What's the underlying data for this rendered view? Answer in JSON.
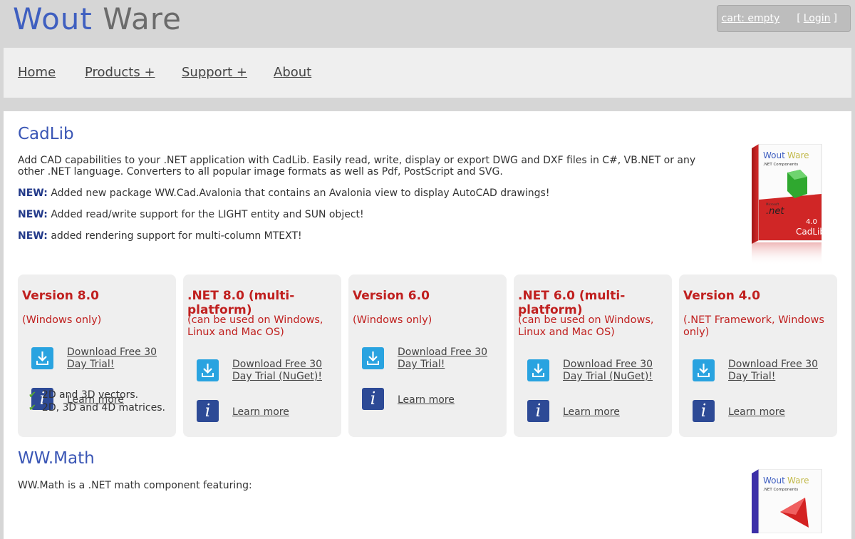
{
  "header": {
    "logo_part1": "Wout",
    "logo_part2": "Ware",
    "cart_label": "cart: empty",
    "login_open": "[",
    "login_label": "Login",
    "login_close": "]"
  },
  "nav": {
    "items": [
      {
        "label": "Home"
      },
      {
        "label": "Products +"
      },
      {
        "label": "Support +"
      },
      {
        "label": "About"
      }
    ]
  },
  "cadlib": {
    "title": "CadLib",
    "intro": "Add CAD capabilities to your .NET application with CadLib. Easily read, write, display or export DWG and DXF files in C#, VB.NET or any other .NET language. Converters to all popular image formats as well as Pdf, PostScript and SVG.",
    "news_label": "NEW:",
    "news": [
      "Added new package WW.Cad.Avalonia that contains an Avalonia view to display AutoCAD drawings!",
      "Added read/write support for the LIGHT entity and SUN object!",
      "added rendering support for multi-column MTEXT!"
    ],
    "box": {
      "brand1": "Wout",
      "brand2": "Ware",
      "subtitle": ".NET Components",
      "ms": "Microsoft",
      "net": ".net",
      "version": "4.0",
      "name": "CadLib"
    },
    "cards": [
      {
        "title": "Version 8.0",
        "subtitle": "(Windows only)",
        "download": "Download Free 30 Day Trial!",
        "learn": "Learn more"
      },
      {
        "title": ".NET 8.0 (multi-platform)",
        "subtitle": "(can be used on Windows, Linux and Mac OS)",
        "download": "Download Free 30 Day Trial (NuGet)!",
        "learn": "Learn more"
      },
      {
        "title": "Version 6.0",
        "subtitle": "(Windows only)",
        "download": "Download Free 30 Day Trial!",
        "learn": "Learn more"
      },
      {
        "title": ".NET 6.0 (multi-platform)",
        "subtitle": "(can be used on Windows, Linux and Mac OS)",
        "download": "Download Free 30 Day Trial (NuGet)!",
        "learn": "Learn more"
      },
      {
        "title": "Version 4.0",
        "subtitle": "(.NET Framework, Windows only)",
        "download": "Download Free 30 Day Trial!",
        "learn": "Learn more"
      }
    ]
  },
  "wwmath": {
    "title": "WW.Math",
    "intro": "WW.Math is a .NET math component featuring:",
    "features": [
      "2D and 3D vectors.",
      "2D, 3D and 4D matrices."
    ],
    "box": {
      "brand1": "Wout",
      "brand2": "Ware",
      "subtitle": ".NET Components"
    }
  },
  "colors": {
    "accent_blue": "#3a56b5",
    "card_red": "#c0201f",
    "download_icon": "#29a3e0",
    "info_icon": "#2d4a96",
    "check_green": "#5aab2c"
  }
}
